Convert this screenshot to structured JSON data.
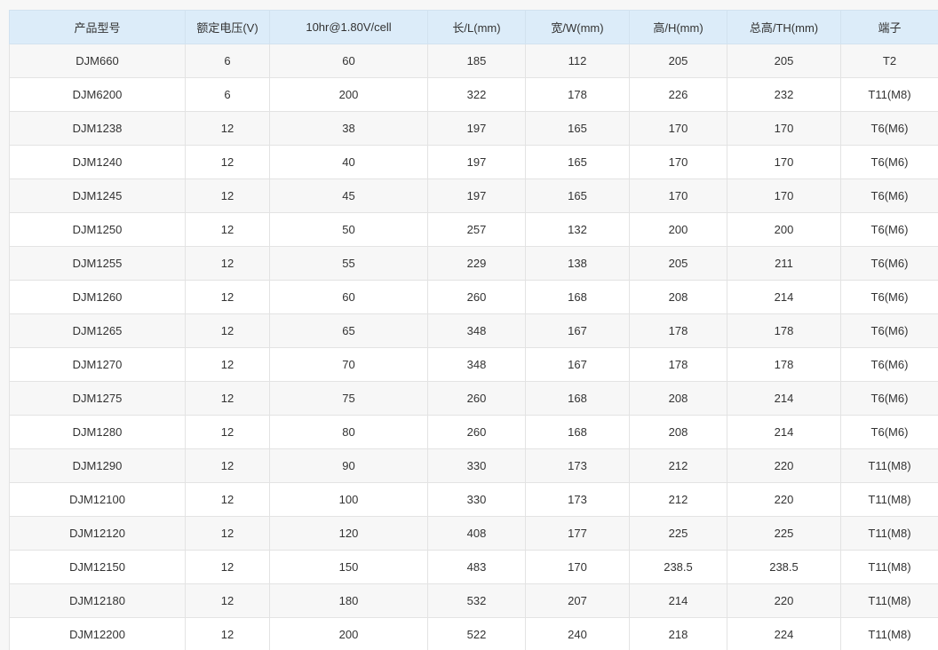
{
  "table": {
    "headers": [
      "产品型号",
      "额定电压(V)",
      "10hr@1.80V/cell",
      "长/L(mm)",
      "宽/W(mm)",
      "高/H(mm)",
      "总高/TH(mm)",
      "端子"
    ],
    "rows": [
      [
        "DJM660",
        "6",
        "60",
        "185",
        "112",
        "205",
        "205",
        "T2"
      ],
      [
        "DJM6200",
        "6",
        "200",
        "322",
        "178",
        "226",
        "232",
        "T11(M8)"
      ],
      [
        "DJM1238",
        "12",
        "38",
        "197",
        "165",
        "170",
        "170",
        "T6(M6)"
      ],
      [
        "DJM1240",
        "12",
        "40",
        "197",
        "165",
        "170",
        "170",
        "T6(M6)"
      ],
      [
        "DJM1245",
        "12",
        "45",
        "197",
        "165",
        "170",
        "170",
        "T6(M6)"
      ],
      [
        "DJM1250",
        "12",
        "50",
        "257",
        "132",
        "200",
        "200",
        "T6(M6)"
      ],
      [
        "DJM1255",
        "12",
        "55",
        "229",
        "138",
        "205",
        "211",
        "T6(M6)"
      ],
      [
        "DJM1260",
        "12",
        "60",
        "260",
        "168",
        "208",
        "214",
        "T6(M6)"
      ],
      [
        "DJM1265",
        "12",
        "65",
        "348",
        "167",
        "178",
        "178",
        "T6(M6)"
      ],
      [
        "DJM1270",
        "12",
        "70",
        "348",
        "167",
        "178",
        "178",
        "T6(M6)"
      ],
      [
        "DJM1275",
        "12",
        "75",
        "260",
        "168",
        "208",
        "214",
        "T6(M6)"
      ],
      [
        "DJM1280",
        "12",
        "80",
        "260",
        "168",
        "208",
        "214",
        "T6(M6)"
      ],
      [
        "DJM1290",
        "12",
        "90",
        "330",
        "173",
        "212",
        "220",
        "T11(M8)"
      ],
      [
        "DJM12100",
        "12",
        "100",
        "330",
        "173",
        "212",
        "220",
        "T11(M8)"
      ],
      [
        "DJM12120",
        "12",
        "120",
        "408",
        "177",
        "225",
        "225",
        "T11(M8)"
      ],
      [
        "DJM12150",
        "12",
        "150",
        "483",
        "170",
        "238.5",
        "238.5",
        "T11(M8)"
      ],
      [
        "DJM12180",
        "12",
        "180",
        "532",
        "207",
        "214",
        "220",
        "T11(M8)"
      ],
      [
        "DJM12200",
        "12",
        "200",
        "522",
        "240",
        "218",
        "224",
        "T11(M8)"
      ]
    ]
  },
  "colors": {
    "header_background": "#dcecf9",
    "row_stripe": "#f7f7f7",
    "grid_line": "#e3e3e3",
    "text": "#333333"
  }
}
